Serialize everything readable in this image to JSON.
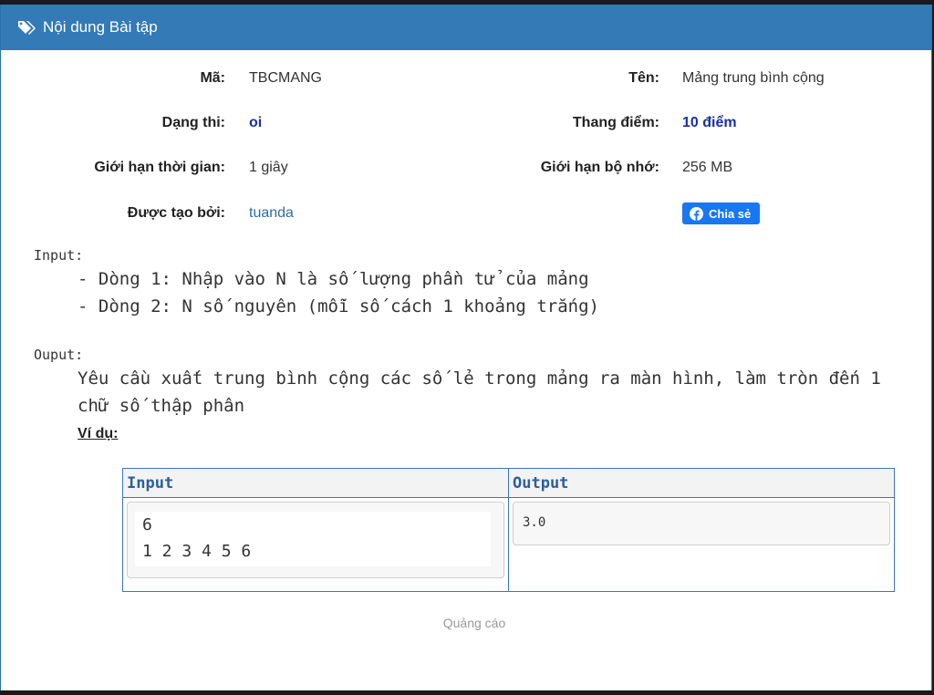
{
  "header": {
    "title": "Nội dung Bài tập",
    "icon": "tags-icon"
  },
  "info": {
    "code_label": "Mã:",
    "code_value": "TBCMANG",
    "name_label": "Tên:",
    "name_value": "Mảng trung bình cộng",
    "type_label": "Dạng thi:",
    "type_value": "oi",
    "score_label": "Thang điểm:",
    "score_value": "10 điểm",
    "time_label": "Giới hạn thời gian:",
    "time_value": "1 giây",
    "memory_label": "Giới hạn bộ nhớ:",
    "memory_value": "256 MB",
    "author_label": "Được tạo bởi:",
    "author_value": "tuanda",
    "share_label": "Chia sẻ"
  },
  "problem": {
    "input_label": "Input:",
    "input_lines": [
      "- Dòng 1: Nhập vào N là số lượng phần tử của mảng",
      "- Dòng 2: N số nguyên (mỗi số cách 1 khoảng trắng)"
    ],
    "output_label": "Ouput:",
    "output_lines": [
      "Yêu cầu xuất trung bình cộng các số lẻ trong mảng ra màn hình, làm tròn đến 1",
      "chữ số thập phân"
    ],
    "example_label": "Ví dụ:"
  },
  "example": {
    "input_header": "Input",
    "output_header": "Output",
    "input_lines": [
      "6",
      "1 2 3 4 5 6"
    ],
    "output_value": "3.0"
  },
  "ad_label": "Quảng cáo",
  "colors": {
    "header_bg": "#337ab7",
    "share_bg": "#1877f2",
    "accent_text": "#1a2fa8"
  }
}
